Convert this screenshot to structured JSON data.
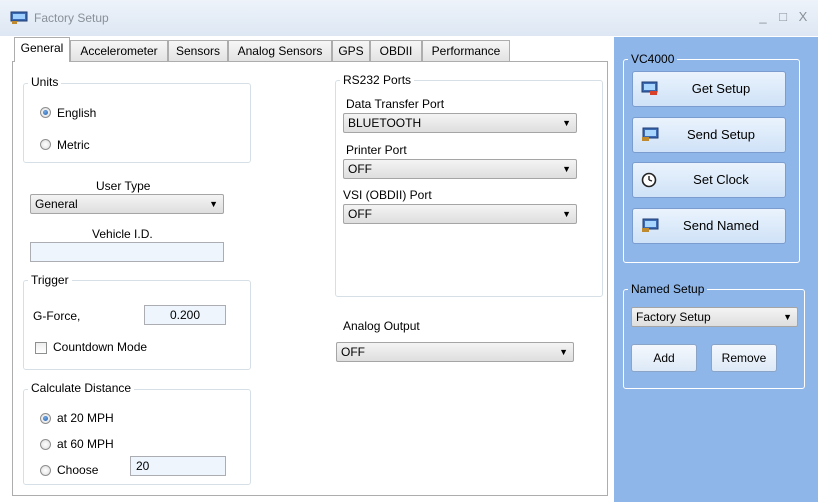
{
  "window": {
    "title": "Factory Setup",
    "controls": [
      "_",
      "□",
      "X"
    ]
  },
  "tabs": [
    "General",
    "Accelerometer",
    "Sensors",
    "Analog Sensors",
    "GPS",
    "OBDII",
    "Performance"
  ],
  "units": {
    "legend": "Units",
    "options": [
      "English",
      "Metric"
    ],
    "selected": "English"
  },
  "user_type": {
    "label": "User Type",
    "value": "General"
  },
  "vehicle_id": {
    "label": "Vehicle I.D.",
    "value": ""
  },
  "trigger": {
    "legend": "Trigger",
    "gforce_label": "G-Force,",
    "gforce_value": "0.200",
    "countdown_label": "Countdown Mode",
    "countdown_checked": false
  },
  "calc_distance": {
    "legend": "Calculate Distance",
    "options": [
      "at 20 MPH",
      "at 60 MPH",
      "Choose"
    ],
    "selected": "at 20 MPH",
    "choose_value": "20"
  },
  "rs232": {
    "legend": "RS232 Ports",
    "data_transfer_label": "Data Transfer Port",
    "data_transfer_value": "BLUETOOTH",
    "printer_label": "Printer Port",
    "printer_value": "OFF",
    "vsi_label": "VSI (OBDII) Port",
    "vsi_value": "OFF"
  },
  "analog_output": {
    "label": "Analog Output",
    "value": "OFF"
  },
  "vc4000": {
    "legend": "VC4000",
    "buttons": [
      "Get Setup",
      "Send Setup",
      "Set Clock",
      "Send Named"
    ]
  },
  "named_setup": {
    "legend": "Named Setup",
    "value": "Factory Setup",
    "add": "Add",
    "remove": "Remove"
  },
  "colors": {
    "panel_bg": "#8fb6e8",
    "button_bg": "#dce9f8",
    "textbox_bg": "#eef5fd"
  }
}
